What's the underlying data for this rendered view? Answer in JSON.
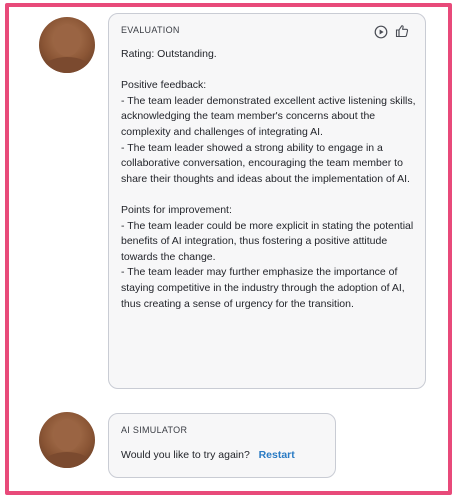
{
  "messages": {
    "evaluation": {
      "title": "EVALUATION",
      "body": "Rating: Outstanding.\n\nPositive feedback:\n- The team leader demonstrated excellent active listening skills, acknowledging the team member's concerns about the complexity and challenges of integrating AI.\n- The team leader showed a strong ability to engage in a collaborative conversation, encouraging the team member to share their thoughts and ideas about the implementation of AI.\n\nPoints for improvement:\n- The team leader could be more explicit in stating the potential benefits of AI integration, thus fostering a positive attitude towards the change.\n- The team leader may further emphasize the importance of staying competitive in the industry through the adoption of AI, thus creating a sense of urgency for the transition.",
      "play_icon": "play-circle-icon",
      "like_icon": "thumbs-up-icon"
    },
    "simulator": {
      "title": "AI SIMULATOR",
      "question": "Would you like to try again?",
      "restart_label": "Restart"
    }
  },
  "colors": {
    "frame_border": "#e84a7a",
    "bubble_bg": "#f7f7f8",
    "bubble_border": "#c9ccd4",
    "link": "#2a7bc4"
  }
}
